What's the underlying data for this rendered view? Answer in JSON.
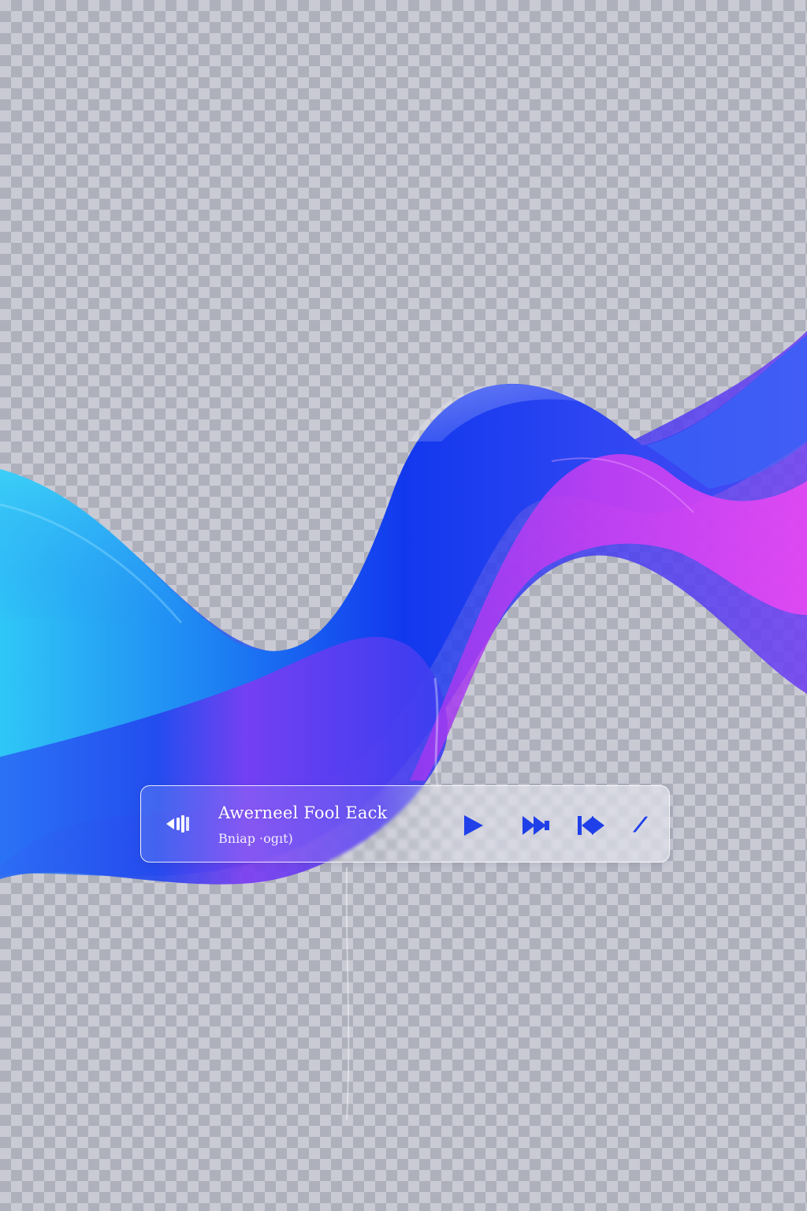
{
  "player": {
    "track_title": "Awerneel Fool Eack",
    "track_subtitle": "Bniap ·ogıt)",
    "extra_label": "⁄⁄"
  },
  "icons": {
    "volume": "volume-icon",
    "play": "play-icon",
    "fast_forward": "fast-forward-icon",
    "skip": "skip-icon"
  },
  "colors": {
    "icon_blue": "#1f3fe8",
    "wave_cyan": "#35c6f4",
    "wave_blue": "#1436f0",
    "wave_violet": "#7a3cf0",
    "wave_magenta": "#e73cf0"
  }
}
